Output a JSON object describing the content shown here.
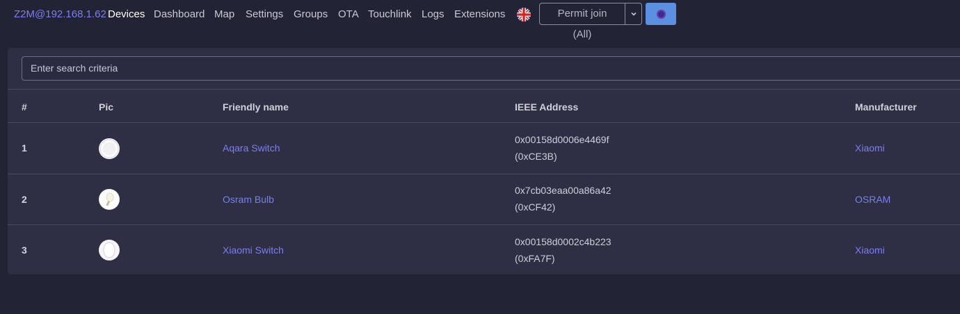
{
  "navbar": {
    "brand": "Z2M@192.168.1.62",
    "links": [
      "Devices",
      "Dashboard",
      "Map",
      "Settings",
      "Groups",
      "OTA",
      "Touchlink",
      "Logs",
      "Extensions"
    ],
    "active_link": "Devices",
    "language_icon": "uk-flag-icon",
    "permit_join_label": "Permit join (All)",
    "theme_icon": "theme-toggle-icon"
  },
  "search": {
    "placeholder": "Enter search criteria"
  },
  "table": {
    "headers": [
      "#",
      "Pic",
      "Friendly name",
      "IEEE Address",
      "Manufacturer"
    ],
    "rows": [
      {
        "num": "1",
        "pic": "aqara-switch-image",
        "name": "Aqara Switch",
        "ieee": "0x00158d0006e4469f",
        "nwk": "(0xCE3B)",
        "manufacturer": "Xiaomi"
      },
      {
        "num": "2",
        "pic": "osram-bulb-image",
        "name": "Osram Bulb",
        "ieee": "0x7cb03eaa00a86a42",
        "nwk": "(0xCF42)",
        "manufacturer": "OSRAM"
      },
      {
        "num": "3",
        "pic": "xiaomi-switch-image",
        "name": "Xiaomi Switch",
        "ieee": "0x00158d0002c4b223",
        "nwk": "(0xFA7F)",
        "manufacturer": "Xiaomi"
      }
    ]
  },
  "colors": {
    "background": "#232336",
    "card": "#2e2f45",
    "link": "#7c7ef0",
    "theme_button": "#5b8fe0"
  }
}
